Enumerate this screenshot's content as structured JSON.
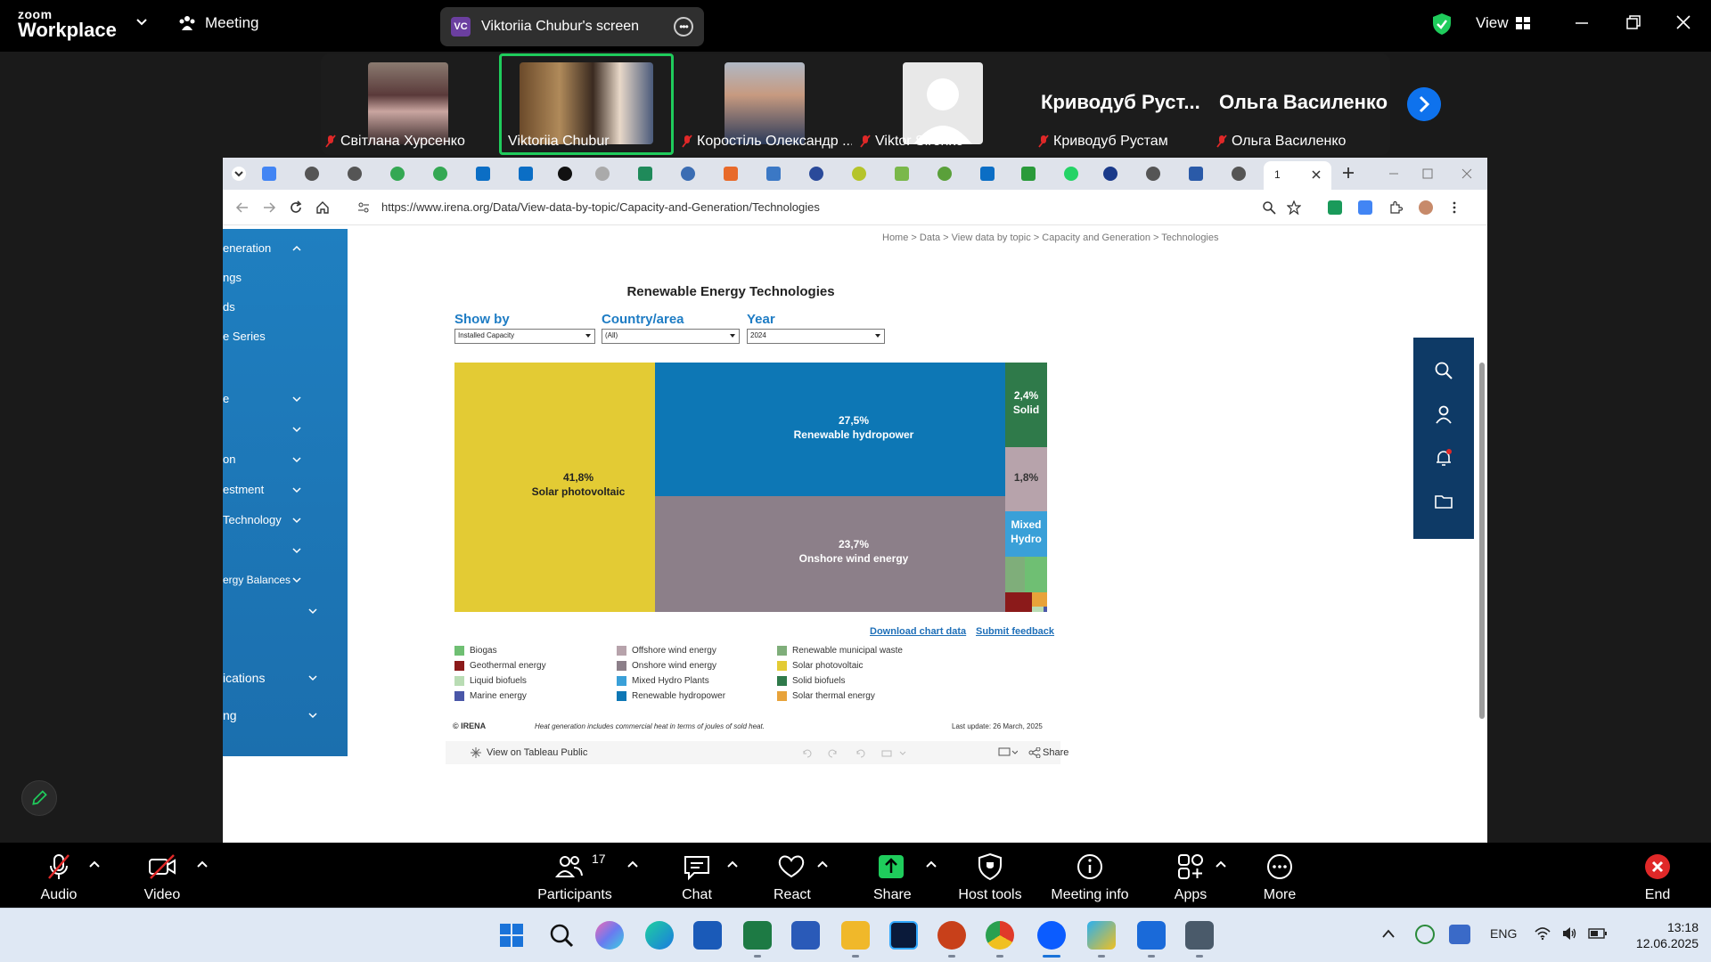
{
  "zoom": {
    "logo_top": "zoom",
    "logo_bottom": "Workplace",
    "meeting_label": "Meeting",
    "share_pill": {
      "initials": "VC",
      "label": "Viktoriia Chubur's screen"
    },
    "view_label": "View"
  },
  "gallery": [
    {
      "name": "Світлана Хурсенко",
      "kind": "photo"
    },
    {
      "name": "Viktoriia Chubur",
      "kind": "photo",
      "active": true
    },
    {
      "name": "Коростіль Олександр ...",
      "kind": "photo"
    },
    {
      "name": "Viktor  Sirenko",
      "kind": "placeholder"
    },
    {
      "name": "Криводуб Рустам",
      "big": "Криводуб  Руст..."
    },
    {
      "name": "Ольга Василенко",
      "big": "Ольга Василенко"
    }
  ],
  "browser": {
    "url": "https://www.irena.org/Data/View-data-by-topic/Capacity-and-Generation/Technologies",
    "active_tab_label": "1",
    "breadcrumb": "Home > Data > View data by topic > Capacity and Generation > Technologies"
  },
  "sidebar": {
    "items": [
      "eneration",
      "ngs",
      "ds",
      "e Series",
      "e",
      "",
      "on",
      "estment",
      "Technology",
      "",
      "ergy Balances",
      "",
      "ications",
      "ng"
    ]
  },
  "viz": {
    "title": "Renewable Energy Technologies",
    "filters": [
      {
        "label": "Show by",
        "value": "Installed Capacity"
      },
      {
        "label": "Country/area",
        "value": "(All)"
      },
      {
        "label": "Year",
        "value": "2024"
      }
    ],
    "download_link": "Download chart data",
    "feedback_link": "Submit feedback",
    "copyright": "© IRENA",
    "note": "Heat generation includes commercial heat in terms of joules of sold heat.",
    "last_update": "Last update: 26 March, 2025",
    "view_on_tableau": "View on Tableau Public",
    "share": "Share"
  },
  "chart_data": {
    "type": "treemap",
    "title": "Renewable Energy Technologies",
    "segments": [
      {
        "name": "Solar photovoltaic",
        "label": "41,8%",
        "value": 41.8,
        "color": "#e3cb34"
      },
      {
        "name": "Renewable hydropower",
        "label": "27,5%",
        "value": 27.5,
        "color": "#0d77b5"
      },
      {
        "name": "Onshore wind energy",
        "label": "23,7%",
        "value": 23.7,
        "color": "#8c7f89"
      },
      {
        "name": "Solid",
        "label": "2,4%",
        "value": 2.4,
        "color": "#2f7a4a"
      },
      {
        "name": "",
        "label": "1,8%",
        "value": 1.8,
        "color": "#b7a3ab"
      },
      {
        "name": "Mixed Hydro",
        "label": "",
        "color": "#3aa0d8"
      }
    ],
    "legend": [
      {
        "name": "Biogas",
        "color": "#6fbf73"
      },
      {
        "name": "Geothermal energy",
        "color": "#8b1a1a"
      },
      {
        "name": "Liquid biofuels",
        "color": "#b9dcb4"
      },
      {
        "name": "Marine energy",
        "color": "#4a57a8"
      },
      {
        "name": "Offshore wind energy",
        "color": "#b7a3ab"
      },
      {
        "name": "Onshore wind energy",
        "color": "#8c7f89"
      },
      {
        "name": "Mixed Hydro Plants",
        "color": "#3aa0d8"
      },
      {
        "name": "Renewable hydropower",
        "color": "#0d77b5"
      },
      {
        "name": "Renewable municipal waste",
        "color": "#7fae7a"
      },
      {
        "name": "Solar photovoltaic",
        "color": "#e3cb34"
      },
      {
        "name": "Solid biofuels",
        "color": "#2f7a4a"
      },
      {
        "name": "Solar thermal energy",
        "color": "#e8a33a"
      }
    ]
  },
  "controls": {
    "audio": "Audio",
    "video": "Video",
    "participants": "Participants",
    "participants_count": "17",
    "chat": "Chat",
    "react": "React",
    "share": "Share",
    "host_tools": "Host tools",
    "meeting_info": "Meeting info",
    "apps": "Apps",
    "more": "More",
    "end": "End"
  },
  "taskbar": {
    "lang": "ENG",
    "time": "13:18",
    "date": "12.06.2025"
  }
}
